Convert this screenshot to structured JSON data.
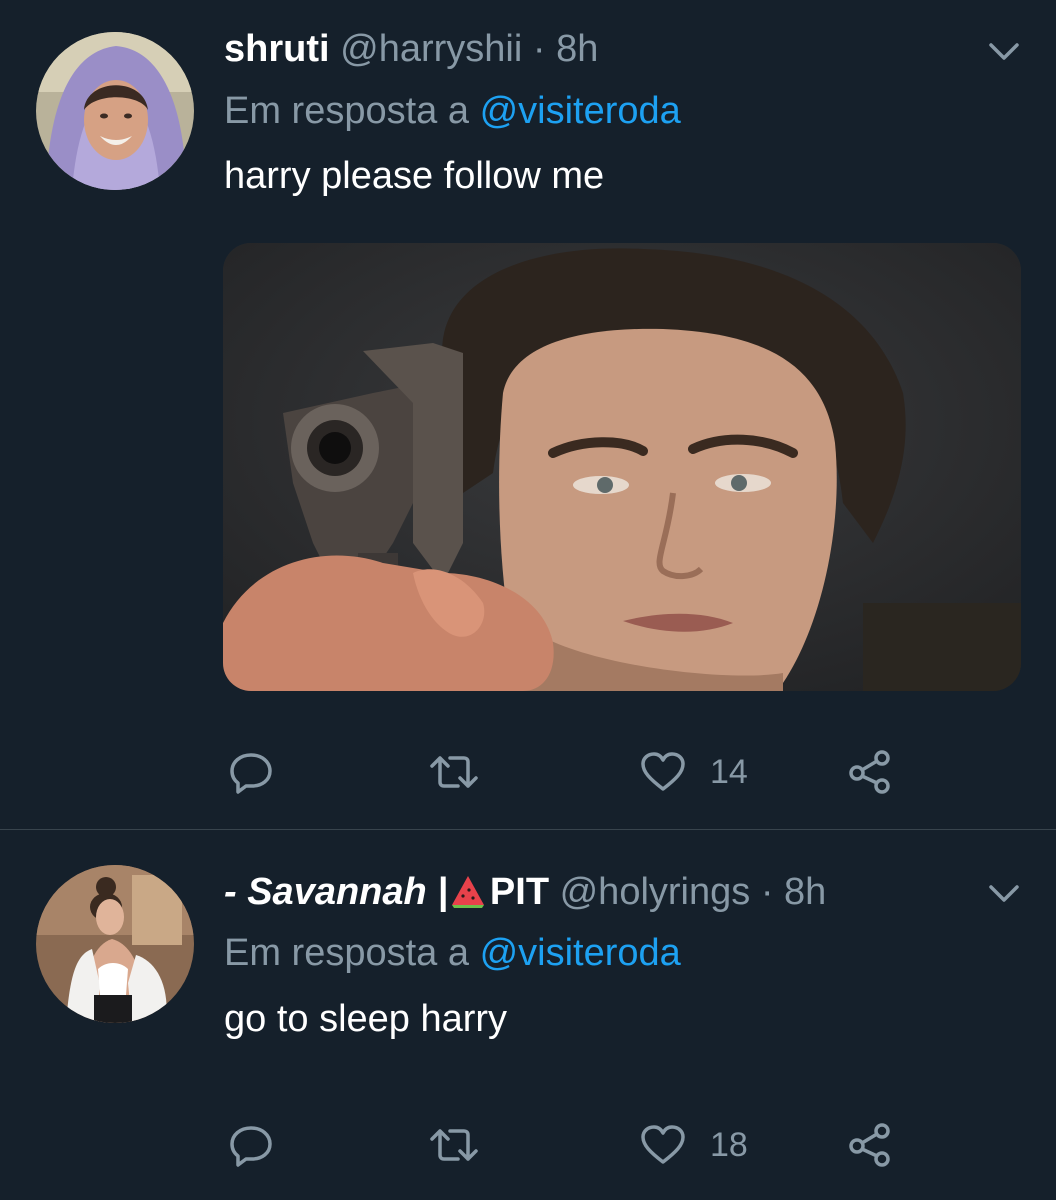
{
  "tweets": [
    {
      "display_name": "shruti",
      "handle": "@harryshii",
      "separator": "·",
      "time": "8h",
      "reply_prefix": "Em resposta a",
      "reply_mention": "@visiteroda",
      "text": "harry please follow me",
      "has_media": true,
      "like_count": "14",
      "icons": [
        "avatar-image",
        "chevron-down-icon",
        "reply-icon",
        "retweet-icon",
        "heart-icon",
        "share-icon"
      ]
    },
    {
      "display_name_part1": "- Savannah |",
      "emoji": "watermelon-emoji",
      "display_name_part2": "PIT",
      "handle": "@holyrings",
      "separator": "·",
      "time": "8h",
      "reply_prefix": "Em resposta a",
      "reply_mention": "@visiteroda",
      "text": "go to sleep harry",
      "like_count": "18",
      "icons": [
        "avatar-image",
        "chevron-down-icon",
        "reply-icon",
        "retweet-icon",
        "heart-icon",
        "share-icon"
      ]
    }
  ],
  "colors": {
    "background": "#15202b",
    "secondary_text": "#8899a6",
    "link": "#1da1f2",
    "divider": "#38444d"
  }
}
